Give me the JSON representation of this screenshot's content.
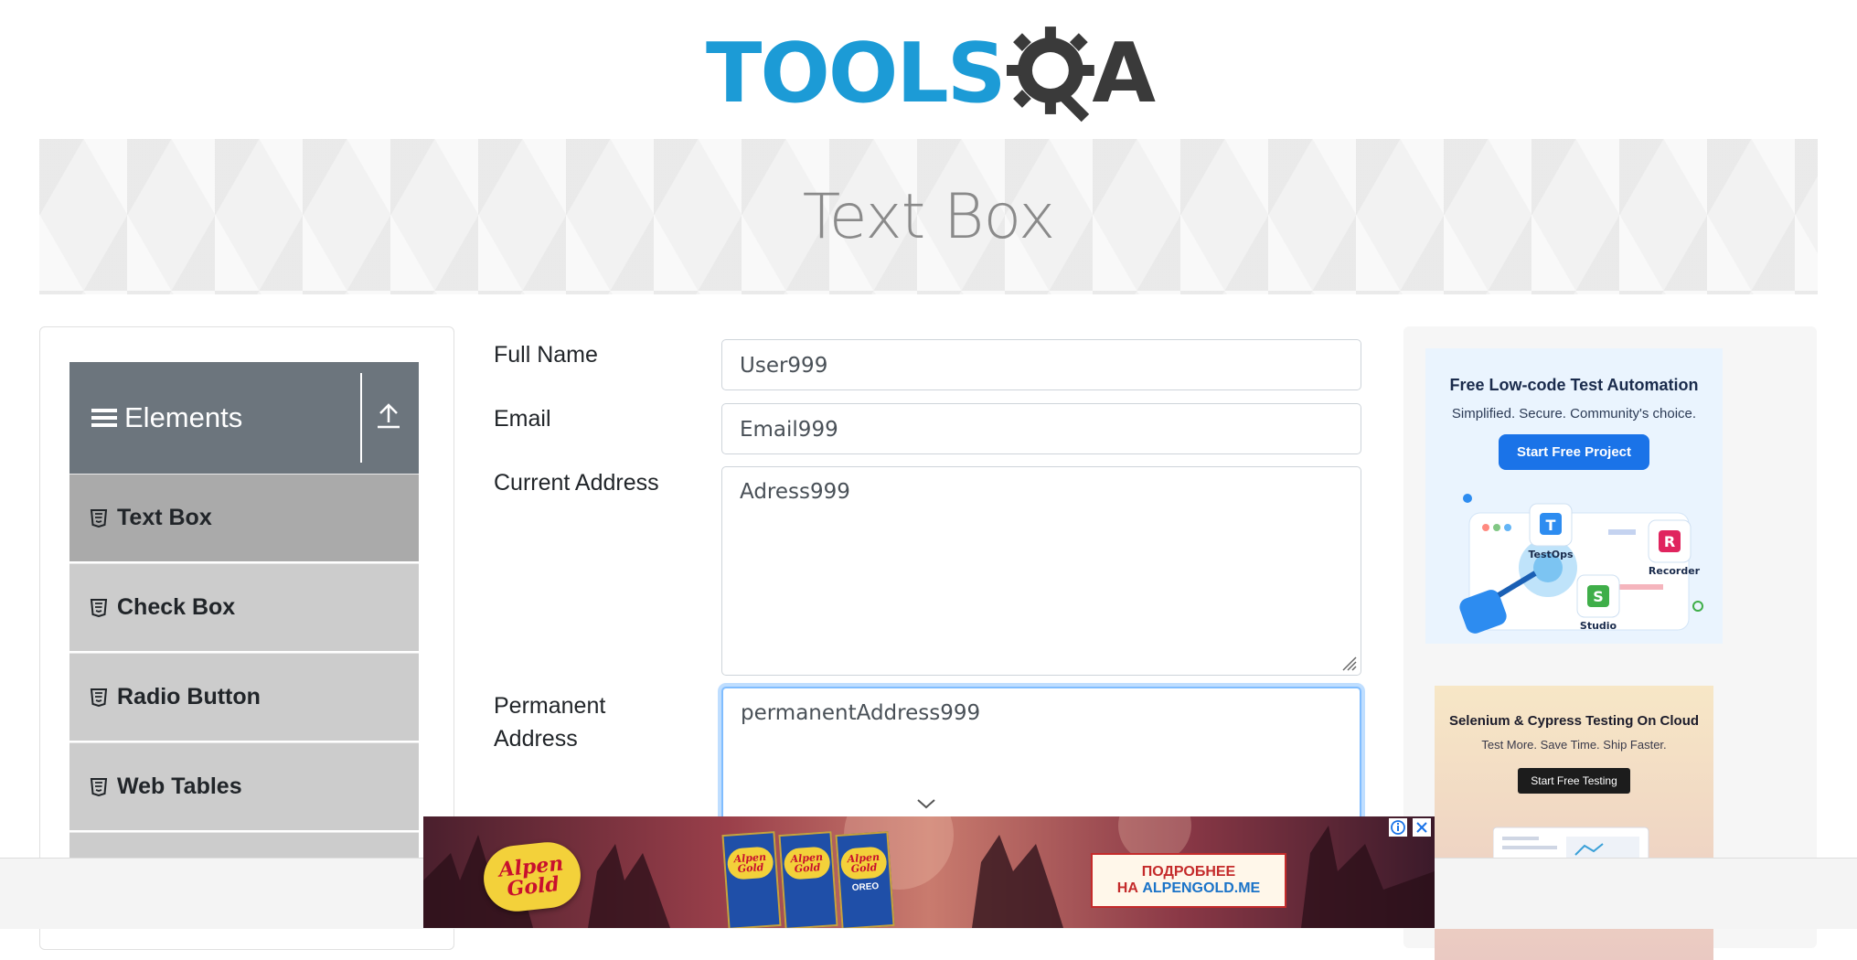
{
  "header": {
    "logo_text": "TOOLS",
    "logo_suffix": "A"
  },
  "banner": {
    "title": "Text Box"
  },
  "sidebar": {
    "group_title": "Elements",
    "items": [
      {
        "label": "Text Box",
        "active": true
      },
      {
        "label": "Check Box",
        "active": false
      },
      {
        "label": "Radio Button",
        "active": false
      },
      {
        "label": "Web Tables",
        "active": false
      }
    ]
  },
  "form": {
    "full_name": {
      "label": "Full Name",
      "value": "User999"
    },
    "email": {
      "label": "Email",
      "value": "Email999"
    },
    "current_address": {
      "label": "Current Address",
      "value": "Adress999"
    },
    "permanent_address": {
      "label_line1": "Permanent",
      "label_line2": "Address",
      "value": "permanentAddress999"
    }
  },
  "ads": {
    "ad1": {
      "title": "Free Low-code Test Automation",
      "subtitle": "Simplified. Secure. Community's choice.",
      "button": "Start Free Project",
      "badges": [
        "TestOps",
        "Recorder",
        "Studio"
      ]
    },
    "ad2": {
      "title": "Selenium & Cypress Testing On Cloud",
      "subtitle": "Test More. Save Time. Ship Faster.",
      "button": "Start Free Testing"
    },
    "bottom": {
      "brand_line1": "Alpen",
      "brand_line2": "Gold",
      "bar_tags": [
        "",
        "",
        "OREO"
      ],
      "cta_line1": "ПОДРОБНЕЕ",
      "cta_line2_prefix": "НА ",
      "cta_line2_site": "ALPENGOLD.ME"
    }
  },
  "colors": {
    "accent": "#1c9bd6",
    "sidebar_header": "#6c757d",
    "menu_item": "#cccccc",
    "menu_item_active": "#aaaaaa",
    "focus_border": "#80bdff"
  }
}
